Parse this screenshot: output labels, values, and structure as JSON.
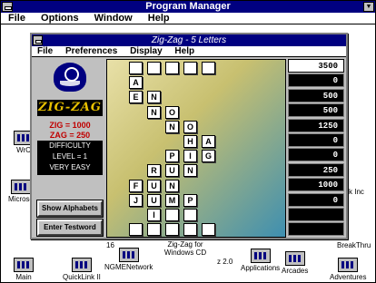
{
  "program_manager": {
    "title": "Program Manager",
    "menu": [
      "File",
      "Options",
      "Window",
      "Help"
    ]
  },
  "desktop_icons": [
    {
      "label": "Main"
    },
    {
      "label": "QuickLink II"
    },
    {
      "label": "NGMENetwork"
    },
    {
      "label": "Zig-Zag for Windows CD"
    },
    {
      "label": "Applications"
    },
    {
      "label": "Arcades"
    },
    {
      "label": "Adventures"
    },
    {
      "label": "BreakThru"
    }
  ],
  "partial_labels": {
    "wrd": "WrC",
    "micro": "Microso",
    "ink": "k Inc",
    "group16": "16",
    "z20": "z 2.0"
  },
  "zigzag": {
    "title": "Zig-Zag - 5 Letters",
    "menu": [
      "File",
      "Preferences",
      "Display",
      "Help"
    ],
    "logo_text": "ZIG-ZAG",
    "zig": "ZIG = 1000",
    "zag": "ZAG = 250",
    "difficulty": [
      "DIFFICULTY",
      "LEVEL = 1",
      "VERY EASY"
    ],
    "buttons": {
      "show_alphabets": "Show Alphabets",
      "enter_testword": "Enter Testword"
    },
    "scores": [
      "3500",
      "0",
      "500",
      "500",
      "1250",
      "0",
      "0",
      "250",
      "1000",
      "0",
      "",
      ""
    ]
  },
  "board": {
    "rows": [
      [
        "",
        "",
        "",
        "",
        ""
      ],
      [
        "A"
      ],
      [
        "E",
        "N"
      ],
      [
        "N",
        "O"
      ],
      [
        "N",
        "O"
      ],
      [
        "H",
        "A"
      ],
      [
        "P",
        "I",
        "G"
      ],
      [
        "R",
        "U",
        "N"
      ],
      [
        "F",
        "U",
        "N"
      ],
      [
        "J",
        "U",
        "M",
        "P"
      ],
      [
        "I",
        "",
        ""
      ],
      [
        "",
        "",
        "",
        "",
        ""
      ]
    ]
  }
}
